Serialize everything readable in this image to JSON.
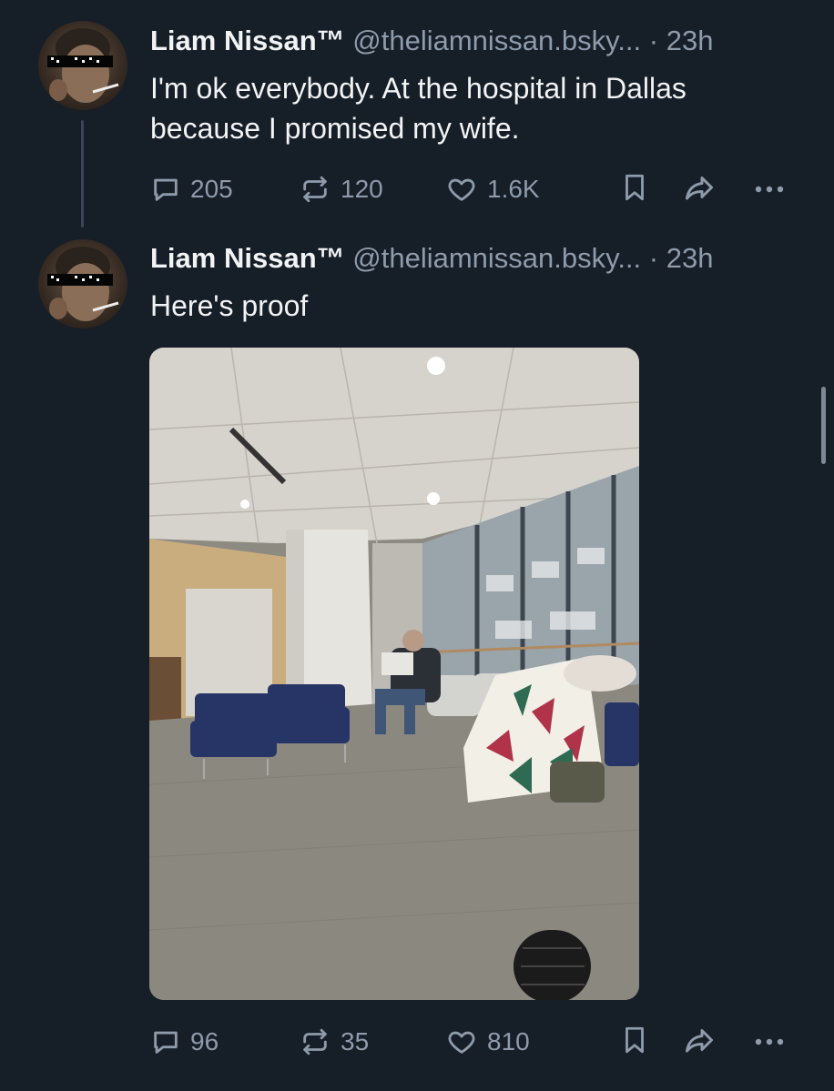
{
  "posts": [
    {
      "author": {
        "name": "Liam Nissan™",
        "handle": "@theliamnissan.bsky...",
        "separator": "·",
        "time": "23h"
      },
      "text_lines": [
        "I'm ok everybody. At the hospital in Dallas",
        "because I promised my wife."
      ],
      "stats": {
        "replies": "205",
        "reposts": "120",
        "likes": "1.6K"
      }
    },
    {
      "author": {
        "name": "Liam Nissan™",
        "handle": "@theliamnissan.bsky...",
        "separator": "·",
        "time": "23h"
      },
      "text_lines": [
        "Here's proof"
      ],
      "stats": {
        "replies": "96",
        "reposts": "35",
        "likes": "810"
      }
    }
  ],
  "icons": {
    "reply": "speech-bubble-icon",
    "repost": "repost-arrows-icon",
    "like": "heart-icon",
    "bookmark": "bookmark-icon",
    "share": "share-arrow-icon",
    "more": "ellipsis-icon"
  },
  "colors": {
    "background": "#161e27",
    "muted_text": "#8d9bab",
    "primary_text": "#f1f3f5",
    "thread_line": "#3a4657"
  }
}
